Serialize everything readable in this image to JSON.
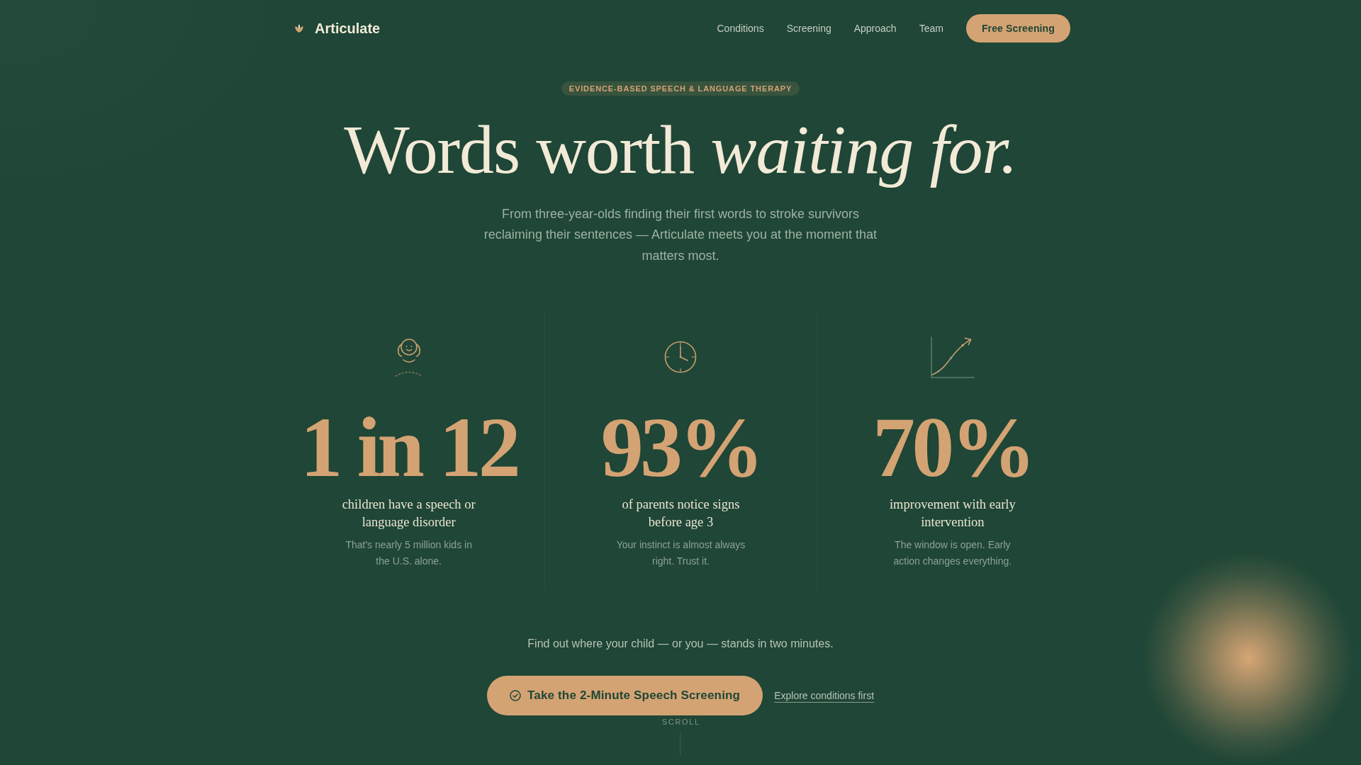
{
  "brand": {
    "name": "Articulate"
  },
  "nav": {
    "links": [
      {
        "label": "Conditions"
      },
      {
        "label": "Screening"
      },
      {
        "label": "Approach"
      },
      {
        "label": "Team"
      }
    ],
    "cta": "Free Screening"
  },
  "hero": {
    "badge": "EVIDENCE-BASED SPEECH & LANGUAGE THERAPY",
    "headline": "Words worth *waiting for.*",
    "subtitle": "From three-year-olds finding their first words to stroke survivors reclaiming their sentences — Articulate meets you at the moment that matters most."
  },
  "stats": [
    {
      "kind": "child",
      "value": "1 in 12",
      "label": "children have a speech or language disorder",
      "note": "That's nearly 5 million kids in the U.S. alone."
    },
    {
      "kind": "clock",
      "value": "93%",
      "label": "of parents notice signs before age 3",
      "note": "Your instinct is almost always right. Trust it."
    },
    {
      "kind": "growth",
      "value": "70%",
      "label": "improvement with early intervention",
      "note": "The window is open. Early action changes everything."
    }
  ],
  "cta_section": {
    "prompt": "Find out where your child — or you — stands in two minutes.",
    "primary_button": "Take the 2-Minute Speech Screening",
    "secondary_link": "Explore conditions first"
  },
  "scroll_hint": "SCROLL"
}
